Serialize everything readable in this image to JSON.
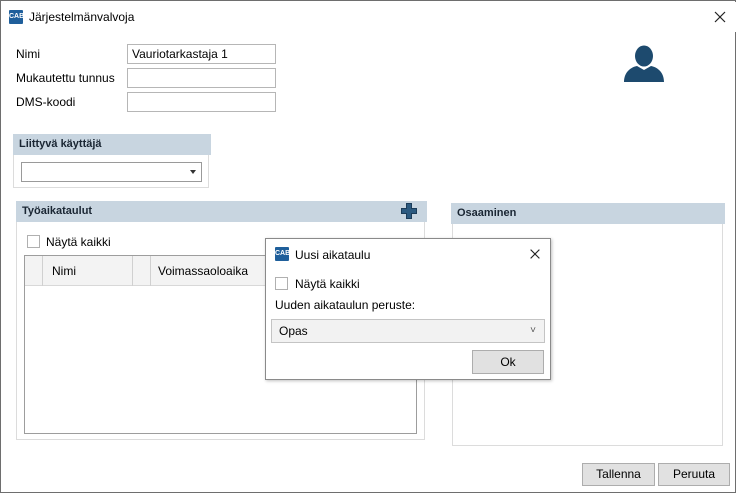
{
  "window": {
    "icon_text": "CAB",
    "title": "Järjestelmänvalvoja"
  },
  "form": {
    "name_label": "Nimi",
    "name_value": "Vauriotarkastaja 1",
    "custom_id_label": "Mukautettu tunnus",
    "custom_id_value": "",
    "dms_label": "DMS-koodi",
    "dms_value": ""
  },
  "linked_user": {
    "heading": "Liittyvä käyttäjä",
    "selected": ""
  },
  "schedules": {
    "heading": "Työaikataulut",
    "show_all_label": "Näytä kaikki",
    "columns": [
      "Nimi",
      "Voimassaoloaika"
    ]
  },
  "skills": {
    "heading": "Osaaminen"
  },
  "footer": {
    "save_label": "Tallenna",
    "cancel_label": "Peruuta"
  },
  "dialog": {
    "icon_text": "CAB",
    "title": "Uusi aikataulu",
    "show_all_label": "Näytä kaikki",
    "basis_label": "Uuden aikataulun peruste:",
    "basis_value": "Opas",
    "ok_label": "Ok"
  },
  "colors": {
    "section_header": "#c8d5e0",
    "brand_icon": "#1f5f9b",
    "avatar": "#1d4a6e"
  }
}
